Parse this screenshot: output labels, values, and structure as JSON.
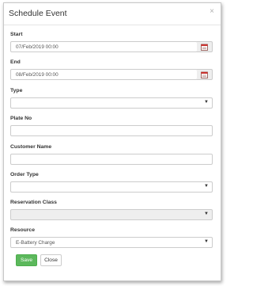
{
  "dialog": {
    "title": "Schedule Event",
    "close_glyph": "×"
  },
  "form": {
    "start": {
      "label": "Start",
      "value": "07/Feb/2019 00:00"
    },
    "end": {
      "label": "End",
      "value": "08/Feb/2019 00:00"
    },
    "type": {
      "label": "Type",
      "value": ""
    },
    "plate_no": {
      "label": "Plate No",
      "value": ""
    },
    "customer_name": {
      "label": "Customer Name",
      "value": ""
    },
    "order_type": {
      "label": "Order Type",
      "value": ""
    },
    "reservation_class": {
      "label": "Reservation Class",
      "value": ""
    },
    "resource": {
      "label": "Resource",
      "value": "E-Battery Charge"
    }
  },
  "buttons": {
    "save": "Save",
    "close": "Close"
  },
  "icons": {
    "calendar": "calendar-icon",
    "caret": "caret-down-icon"
  },
  "colors": {
    "save_green": "#5cb85c",
    "calendar_red": "#c9302c",
    "disabled_gray": "#eeeeee"
  }
}
